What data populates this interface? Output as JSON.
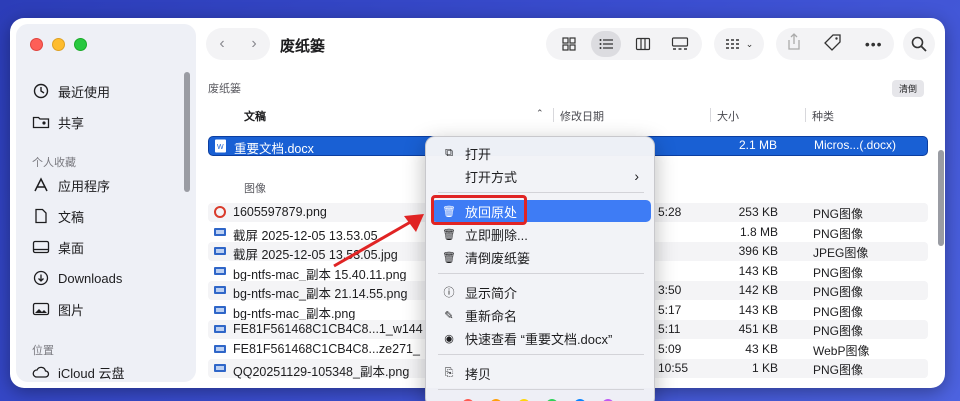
{
  "window": {
    "title": "废纸篓"
  },
  "sidebar": {
    "items_top": [
      {
        "label": "最近使用",
        "icon": "clock-icon"
      },
      {
        "label": "共享",
        "icon": "shared-folder-icon"
      }
    ],
    "favorites_header": "个人收藏",
    "favorites": [
      {
        "label": "应用程序",
        "icon": "apps-icon"
      },
      {
        "label": "文稿",
        "icon": "document-icon"
      },
      {
        "label": "桌面",
        "icon": "desktop-icon"
      },
      {
        "label": "Downloads",
        "icon": "download-icon"
      },
      {
        "label": "图片",
        "icon": "photo-icon"
      }
    ],
    "locations_header": "位置",
    "locations": [
      {
        "label": "iCloud 云盘",
        "icon": "cloud-icon"
      }
    ]
  },
  "pathbar": {
    "label": "废纸篓",
    "empty_button": "清倒"
  },
  "columns": {
    "name": "文稿",
    "date": "修改日期",
    "size": "大小",
    "kind": "种类"
  },
  "selected_file": {
    "name": "重要文档.docx",
    "size": "2.1 MB",
    "kind": "Micros...(.docx)"
  },
  "group_label": "图像",
  "files": [
    {
      "name": "1605597879.png",
      "date": "5:28",
      "size": "253 KB",
      "kind": "PNG图像"
    },
    {
      "name": "截屏 2025-12-05 13.53.05",
      "date": "",
      "size": "1.8 MB",
      "kind": "PNG图像"
    },
    {
      "name": "截屏 2025-12-05 13.53.05.jpg",
      "date": "",
      "size": "396 KB",
      "kind": "JPEG图像"
    },
    {
      "name": "bg-ntfs-mac_副本 15.40.11.png",
      "date": "",
      "size": "143 KB",
      "kind": "PNG图像"
    },
    {
      "name": "bg-ntfs-mac_副本 21.14.55.png",
      "date": "3:50",
      "size": "142 KB",
      "kind": "PNG图像"
    },
    {
      "name": "bg-ntfs-mac_副本.png",
      "date": "5:17",
      "size": "143 KB",
      "kind": "PNG图像"
    },
    {
      "name": "FE81F561468C1CB4C8...1_w144",
      "date": "5:11",
      "size": "451 KB",
      "kind": "PNG图像"
    },
    {
      "name": "FE81F561468C1CB4C8...ze271_",
      "date": "5:09",
      "size": "43 KB",
      "kind": "WebP图像"
    },
    {
      "name": "QQ20251129-105348_副本.png",
      "date": "10:55",
      "size": "1 KB",
      "kind": "PNG图像"
    }
  ],
  "context_menu": {
    "open": "打开",
    "open_with": "打开方式",
    "put_back": "放回原处",
    "delete_now": "立即删除...",
    "empty_trash": "清倒废纸篓",
    "get_info": "显示简介",
    "rename": "重新命名",
    "quick_look": "快速查看 “重要文档.docx”",
    "copy": "拷贝"
  },
  "colors": {
    "accent": "#1960d4",
    "highlight": "#3e7cf5",
    "annotation": "#e02424"
  }
}
